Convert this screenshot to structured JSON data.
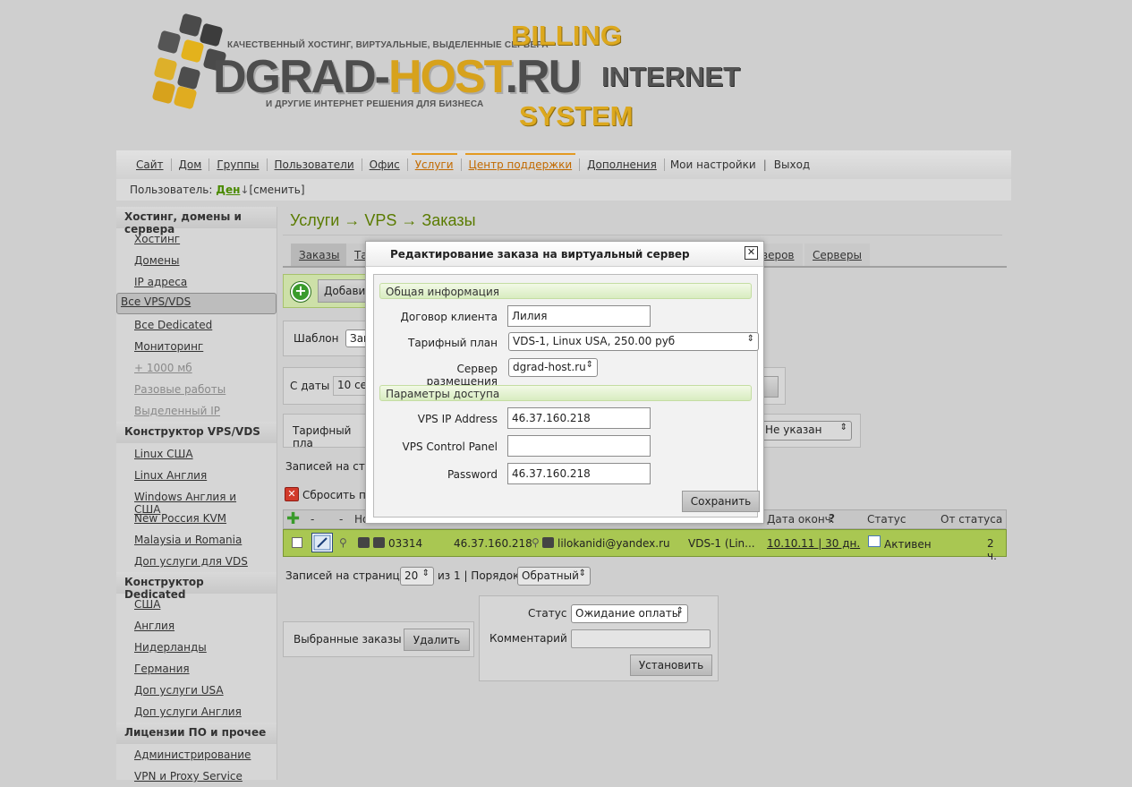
{
  "logo": {
    "tagline": "КАЧЕСТВЕННЫЙ ХОСТИНГ, ВИРТУАЛЬНЫЕ, ВЫДЕЛЕННЫЕ СЕРВЕРА",
    "name_part1": "DGRAD-",
    "name_part2": "HOST",
    "name_part3": ".RU",
    "subline": "И ДРУГИЕ ИНТЕРНЕТ РЕШЕНИЯ ДЛЯ БИЗНЕСА",
    "billing": "BILLING",
    "internet": "INTERNET",
    "system": "SYSTEM",
    "colors": {
      "accent": "#dca81e",
      "dark": "#4d4d4d"
    }
  },
  "topnav": {
    "items": [
      "Сайт",
      "Дом",
      "Группы",
      "Пользователи",
      "Офис",
      "Услуги",
      "Центр поддержки",
      "Дополнения"
    ],
    "settings": "Мои настройки",
    "sep": "|",
    "logout": "Выход"
  },
  "userbar": {
    "label": "Пользователь:",
    "username": "Ден",
    "arrow": "↓",
    "change": "[сменить]"
  },
  "sidebar": {
    "sections": [
      {
        "title": "Хостинг, домены и сервера",
        "items": [
          "Хостинг",
          "Домены",
          "IP адреса",
          "Все VPS/VDS",
          "Все Dedicated",
          "Мониторинг",
          "+ 1000 мб",
          "Разовые работы",
          "Выделенный IP"
        ]
      },
      {
        "title": "Конструктор VPS/VDS",
        "items": [
          "Linux США",
          "Linux Англия",
          "Windows Англия и США",
          "New Россия KVM",
          "Malaysia и Romania",
          "Доп услуги для VDS"
        ]
      },
      {
        "title": "Конструктор Dedicated",
        "items": [
          "США",
          "Англия",
          "Нидерланды",
          "Германия",
          "Доп услуги USA",
          "Доп услуги Англия"
        ]
      },
      {
        "title": "Лицензии ПО и прочее",
        "items": [
          "Администрирование",
          "VPN и Proxy Service"
        ]
      }
    ]
  },
  "main": {
    "title": "Услуги → VPS → Заказы",
    "tabs": [
      "Заказы",
      "Та",
      "веров",
      "Серверы"
    ],
    "add_label": "Добавит",
    "template_label": "Шаблон",
    "template_value": "Зак",
    "date_label": "С даты",
    "date_value": "10 се",
    "plan_label": "Тарифный пла",
    "plan_filter_value": "Не указан",
    "records_label_top": "Записей на стра",
    "reset_label": "Сбросить па"
  },
  "table": {
    "headers": {
      "dash1": "-",
      "dash2": "-",
      "no": "Но",
      "end_date": "Дата оконч.",
      "help": "?",
      "status": "Статус",
      "from_status": "От статуса"
    },
    "row": {
      "order_id": "03314",
      "ip": "46.37.160.218",
      "email": "lilokanidi@yandex.ru",
      "plan": "VDS-1 (Lin...",
      "end_date": "10.10.11 | 30 дн.",
      "status": "Активен",
      "since": "2 ч."
    }
  },
  "pagination": {
    "label": "Записей на странице:",
    "per_page": "20",
    "of": "из 1 | Порядок:",
    "order": "Обратный"
  },
  "bulk": {
    "label": "Выбранные заказы",
    "delete": "Удалить",
    "status_label": "Статус",
    "status_value": "Ожидание оплаты",
    "comment_label": "Комментарий",
    "comment_value": "",
    "set_button": "Установить"
  },
  "modal": {
    "title": "Редактирование заказа на виртуальный сервер",
    "close": "✕",
    "section_general": "Общая информация",
    "contract_label": "Договор клиента",
    "contract_value": "Лилия",
    "plan_label": "Тарифный план",
    "plan_value": "VDS-1, Linux USA, 250.00 руб",
    "server_label": "Сервер размещения",
    "server_value": "dgrad-host.ru",
    "section_access": "Параметры доступа",
    "ip_label": "VPS IP Address",
    "ip_value": "46.37.160.218",
    "panel_label": "VPS Control Panel",
    "panel_value": "",
    "password_label": "Password",
    "password_value": "46.37.160.218",
    "save": "Сохранить"
  }
}
